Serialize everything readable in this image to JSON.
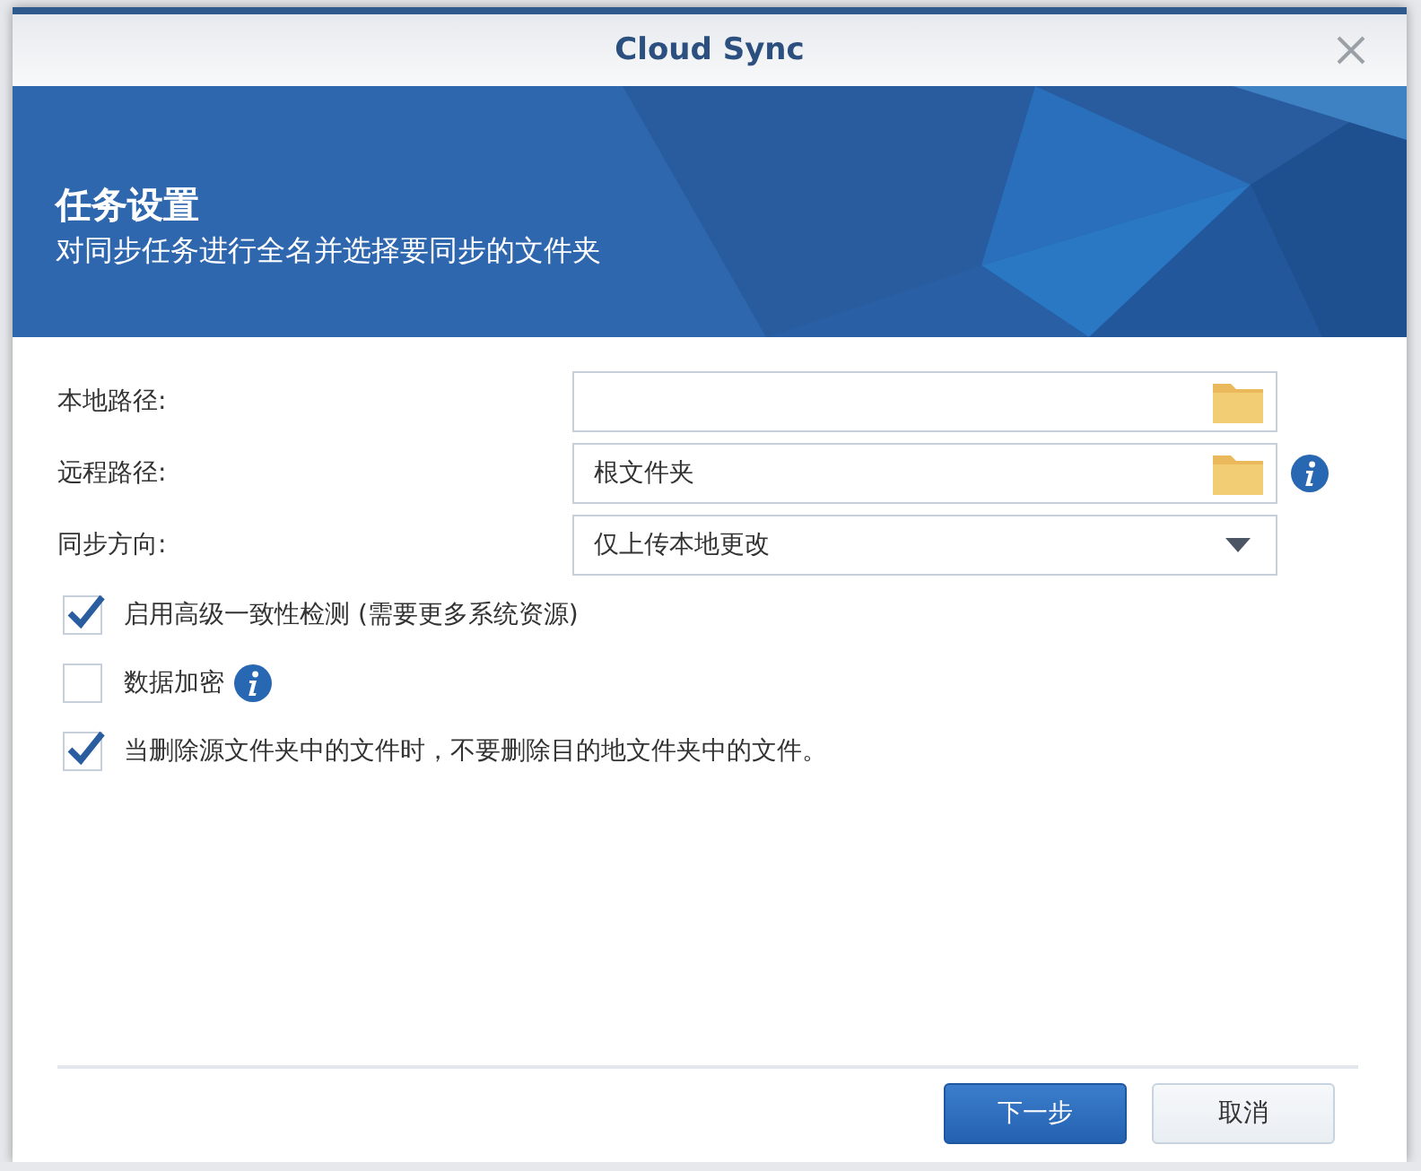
{
  "window": {
    "title": "Cloud Sync"
  },
  "banner": {
    "title": "任务设置",
    "subtitle": "对同步任务进行全名并选择要同步的文件夹"
  },
  "fields": [
    {
      "kind": "folder",
      "label": "本地路径:",
      "info": false
    },
    {
      "kind": "folder",
      "label": "远程路径:",
      "value": "根文件夹",
      "info": true
    },
    {
      "kind": "select",
      "label": "同步方向:",
      "value": "仅上传本地更改",
      "info": false
    }
  ],
  "options": [
    {
      "label": "启用高级一致性检测 (需要更多系统资源)",
      "checked": true,
      "info": false
    },
    {
      "label": "数据加密",
      "checked": false,
      "info": true
    },
    {
      "label": "当删除源文件夹中的文件时，不要删除目的地文件夹中的文件。",
      "checked": true,
      "info": false
    }
  ],
  "buttons": [
    {
      "label": "下一步",
      "kind": "primary"
    },
    {
      "label": "取消",
      "kind": "secondary"
    }
  ]
}
